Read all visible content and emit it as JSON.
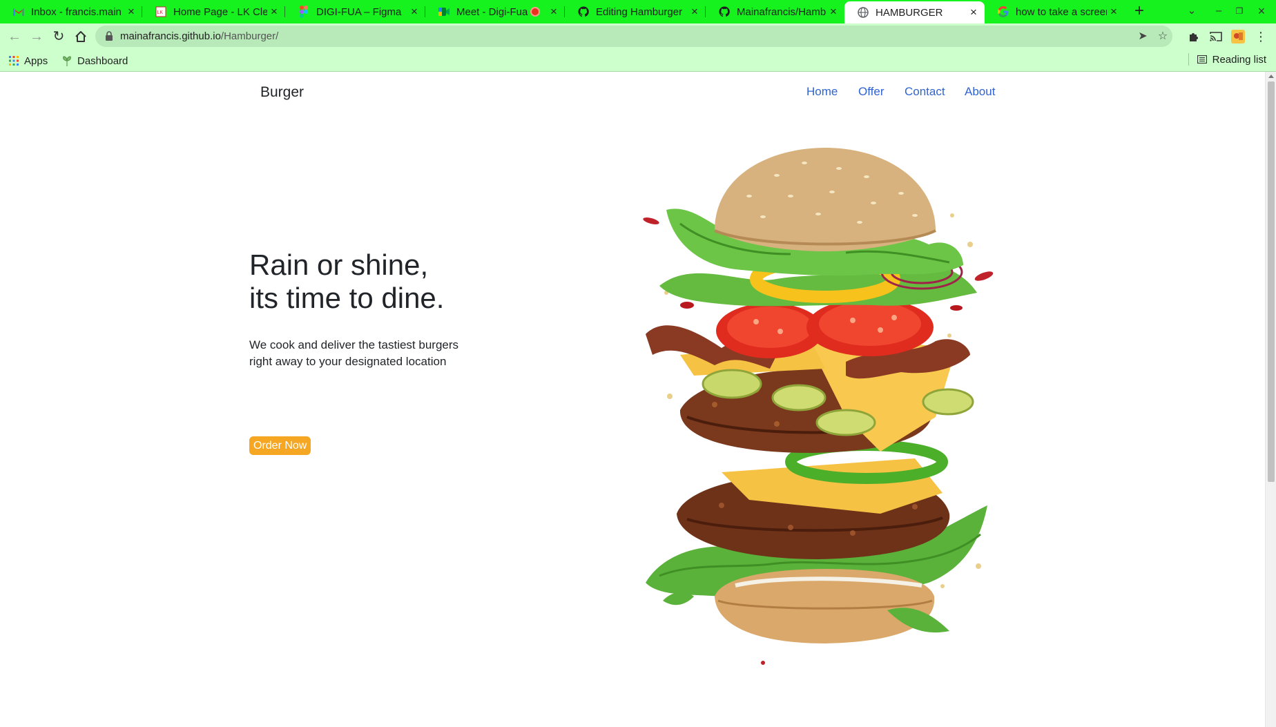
{
  "browser": {
    "tabs": [
      {
        "title": "Inbox - francis.main",
        "favicon": "gmail-icon"
      },
      {
        "title": "Home Page - LK Clea",
        "favicon": "site-icon"
      },
      {
        "title": "DIGI-FUA – Figma",
        "favicon": "figma-icon"
      },
      {
        "title": "Meet - Digi-Fua",
        "favicon": "meet-icon"
      },
      {
        "title": "Editing Hamburger",
        "favicon": "github-icon"
      },
      {
        "title": "Mainafrancis/Hamb",
        "favicon": "github-icon"
      },
      {
        "title": "HAMBURGER",
        "favicon": "globe-icon",
        "active": true
      },
      {
        "title": "how to take a screen",
        "favicon": "google-icon"
      }
    ],
    "url_host": "mainafrancis.github.io",
    "url_path": "/Hamburger/",
    "bookmarks": [
      {
        "label": "Apps",
        "icon": "apps-grid-icon"
      },
      {
        "label": "Dashboard",
        "icon": "dashboard-icon"
      }
    ],
    "reading_list_label": "Reading list",
    "colors": {
      "frame": "#16f21e",
      "toolbar": "#ccffcc",
      "omnibox": "#b8e9b8"
    }
  },
  "page": {
    "brand": "Burger",
    "nav": [
      "Home",
      "Offer",
      "Contact",
      "About"
    ],
    "headline": [
      "Rain or shine,",
      "its time to dine."
    ],
    "subtext": [
      "We cook and deliver the tastiest burgers",
      "right away to your designated location"
    ],
    "cta": "Order Now",
    "hero_image": "stacked-burger-illustration",
    "colors": {
      "link": "#2f63d1",
      "cta": "#f5a623",
      "text": "#212529"
    }
  }
}
